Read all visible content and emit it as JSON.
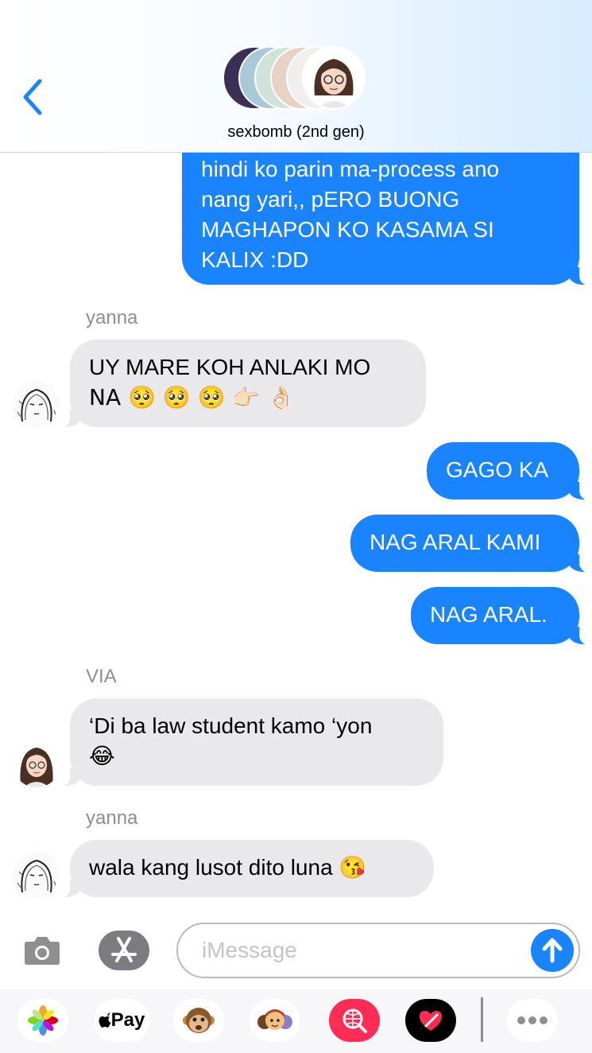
{
  "header": {
    "group_name": "sexbomb (2nd gen)",
    "back_icon": "chevron-left-icon"
  },
  "messages": [
    {
      "direction": "outgoing",
      "lines": [
        "hindi ko parin ma-process ano",
        "nang yari,, pERO BUONG",
        "MAGHAPON KO KASAMA SI",
        "KALIX :DD"
      ]
    },
    {
      "direction": "incoming",
      "sender": "yanna",
      "lines": [
        "UY MARE KOH ANLAKI MO",
        "NA 🥺 🥺 🥺 👉🏻 👌🏻"
      ]
    },
    {
      "direction": "outgoing",
      "text": "GAGO KA"
    },
    {
      "direction": "outgoing",
      "text": "NAG ARAL KAMI"
    },
    {
      "direction": "outgoing",
      "text": "NAG ARAL."
    },
    {
      "direction": "incoming",
      "sender": "VIA",
      "lines": [
        "‘Di ba law student kamo ‘yon",
        "😂"
      ]
    },
    {
      "direction": "incoming",
      "sender": "yanna",
      "text": "wala kang lusot dito luna 😘"
    }
  ],
  "input": {
    "placeholder": "iMessage",
    "camera_icon": "camera-icon",
    "appstore_icon": "app-store-icon",
    "send_icon": "send-arrow-icon"
  },
  "app_drawer": {
    "items": [
      "photos-icon",
      "apple-pay-icon",
      "animoji-icon",
      "memoji-icon",
      "web-images-icon",
      "digital-touch-icon",
      "more-icon"
    ],
    "pay_label": "Pay"
  },
  "colors": {
    "outgoing_bubble": "#1a84ff",
    "incoming_bubble": "#e9e9eb",
    "accent": "#1a84ff",
    "sender_label": "#8e8e93"
  }
}
